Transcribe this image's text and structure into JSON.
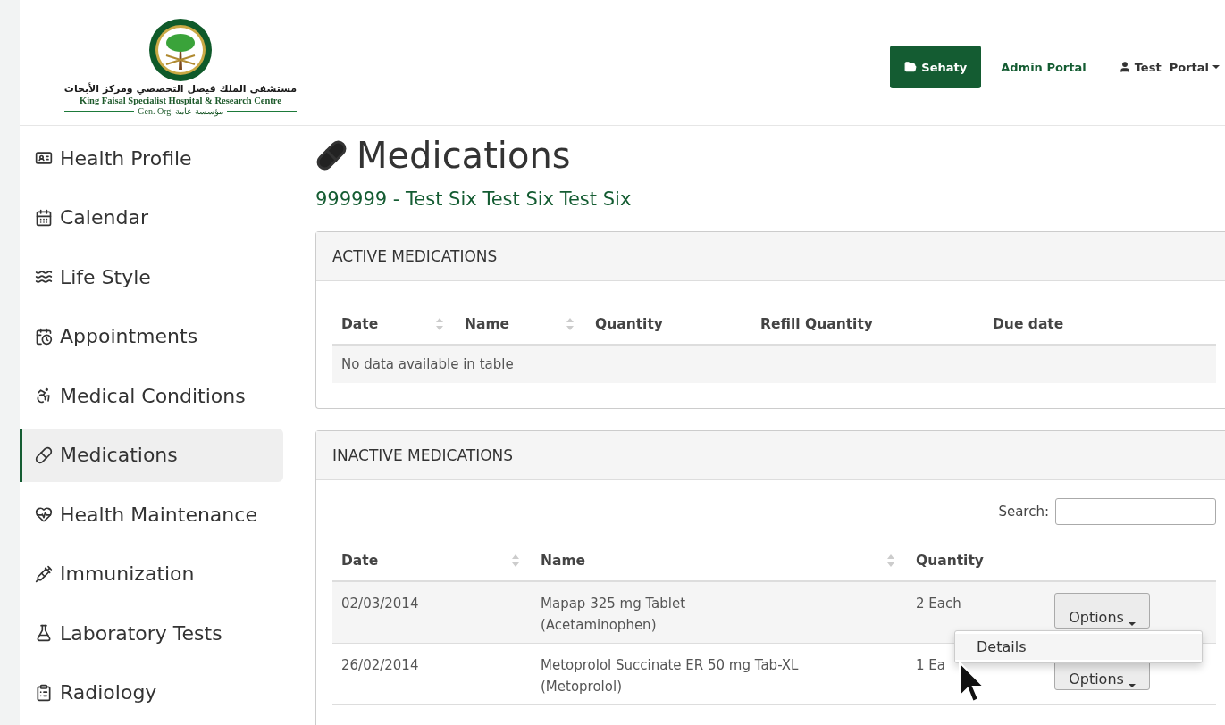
{
  "logo": {
    "arabic": "مستشفى الملك فيصل التخصصي ومركز الأبحاث",
    "english": "King Faisal Specialist Hospital & Research Centre",
    "sub": "Gen. Org. مؤسسة عامة"
  },
  "nav": {
    "primary": "Sehaty",
    "link": "Admin Portal",
    "user": "Test  Portal"
  },
  "sidebar": {
    "items": [
      {
        "label": "Health Profile",
        "selected": false
      },
      {
        "label": "Calendar",
        "selected": false
      },
      {
        "label": "Life Style",
        "selected": false
      },
      {
        "label": "Appointments",
        "selected": false
      },
      {
        "label": "Medical Conditions",
        "selected": false
      },
      {
        "label": "Medications",
        "selected": true
      },
      {
        "label": "Health Maintenance",
        "selected": false
      },
      {
        "label": "Immunization",
        "selected": false
      },
      {
        "label": "Laboratory Tests",
        "selected": false
      },
      {
        "label": "Radiology",
        "selected": false
      }
    ]
  },
  "page": {
    "title": "Medications",
    "patient": "999999 - Test Six Test Six Test Six"
  },
  "panels": [
    {
      "title": "ACTIVE MEDICATIONS",
      "columns": [
        {
          "label": "Date",
          "sortable": true
        },
        {
          "label": "Name",
          "sortable": true
        },
        {
          "label": "Quantity",
          "sortable": false
        },
        {
          "label": "Refill Quantity",
          "sortable": false
        },
        {
          "label": "Due date",
          "sortable": false
        }
      ],
      "empty": "No data available in table"
    },
    {
      "title": "INACTIVE MEDICATIONS",
      "search_label": "Search:",
      "columns": [
        {
          "label": "Date",
          "sortable": true
        },
        {
          "label": "Name",
          "sortable": true
        },
        {
          "label": "Quantity",
          "sortable": false
        }
      ],
      "rows": [
        {
          "date": "02/03/2014",
          "name": "Mapap 325 mg Tablet",
          "generic": "(Acetaminophen)",
          "quantity": "2 Each",
          "button": "Options"
        },
        {
          "date": "26/02/2014",
          "name": "Metoprolol Succinate ER 50 mg Tab-XL",
          "generic": "(Metoprolol)",
          "quantity": "1 Ea",
          "button": "Options"
        }
      ]
    }
  ],
  "menu": {
    "items": [
      "Details"
    ]
  }
}
